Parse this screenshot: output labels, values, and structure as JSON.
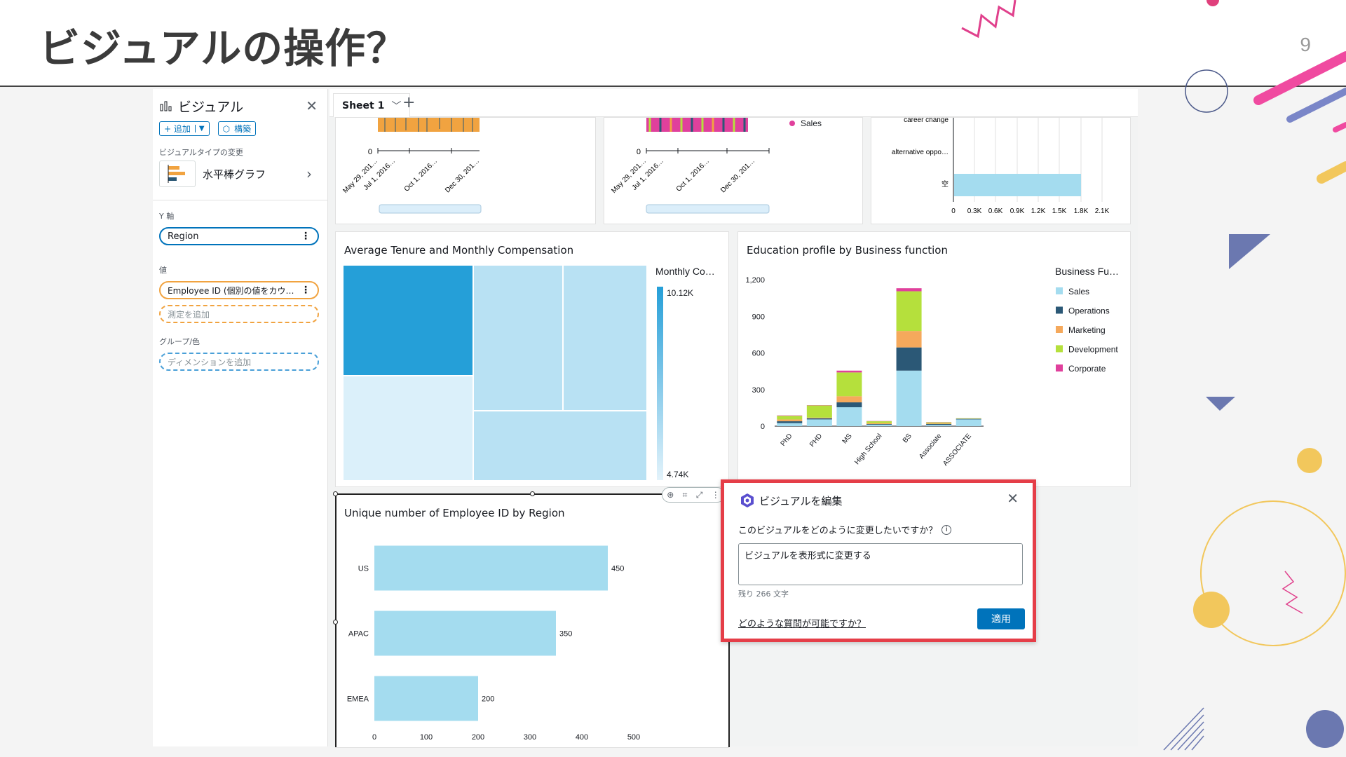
{
  "slide": {
    "title": "ビジュアルの操作？",
    "page_number": "9"
  },
  "left_panel": {
    "title": "ビジュアル",
    "add_button": "+ 追加",
    "build_button": "構築",
    "visual_type_label": "ビジュアルタイプの変更",
    "visual_type_name": "水平棒グラフ",
    "y_axis_label": "Y 軸",
    "y_axis_field": "Region",
    "value_label": "値",
    "value_field": "Employee ID (個別の値をカウ…",
    "add_measure": "測定を追加",
    "group_label": "グループ/色",
    "add_dimension": "ディメンションを追加"
  },
  "sheet_tab": {
    "label": "Sheet 1"
  },
  "top_charts": {
    "left": {
      "zero": "0",
      "dates": [
        "May 29, 201…",
        "Jul 1, 2016…",
        "Oct 1, 2016…",
        "Dec 30, 201…"
      ]
    },
    "middle": {
      "zero": "0",
      "dates": [
        "May 29, 201…",
        "Jul 1, 2016…",
        "Oct 1, 2016…",
        "Dec 30, 201…"
      ],
      "legend": "Sales"
    },
    "right": {
      "categories": [
        "career change",
        "alternative oppo…",
        "空"
      ],
      "ticks": [
        "0",
        "0.3K",
        "0.6K",
        "0.9K",
        "1.2K",
        "1.5K",
        "1.8K",
        "2.1K"
      ]
    }
  },
  "treemap_card": {
    "title": "Average Tenure and Monthly Compensation",
    "legend_title": "Monthly Co…",
    "legend_max": "10.12K",
    "legend_min": "4.74K"
  },
  "education_card": {
    "title": "Education profile by Business function",
    "legend_title": "Business Fu…"
  },
  "bar_card": {
    "title": "Unique number of Employee ID by Region"
  },
  "edit_popup": {
    "title": "ビジュアルを編集",
    "question": "このビジュアルをどのように変更したいですか？",
    "input_value": "ビジュアルを表形式に変更する",
    "remaining": "残り 266 文字",
    "help_link": "どのような質問が可能ですか？",
    "apply": "適用"
  },
  "colors": {
    "accent_blue": "#0073bb",
    "highlight_red": "#e53e48",
    "sales": "#a4dcef",
    "operations": "#2b5876",
    "marketing": "#f5a95c",
    "development": "#b5e03c",
    "corporate": "#e0409c"
  },
  "chart_data": [
    {
      "type": "bar",
      "orientation": "horizontal",
      "title": "Unique number of Employee ID by Region",
      "categories": [
        "US",
        "APAC",
        "EMEA"
      ],
      "values": [
        450,
        350,
        200
      ],
      "xlim": [
        0,
        500
      ],
      "xticks": [
        "0",
        "100",
        "200",
        "300",
        "400",
        "500"
      ]
    },
    {
      "type": "bar",
      "stacked": true,
      "title": "Education profile by Business function",
      "categories": [
        "PhD",
        "PHD",
        "MS",
        "High School",
        "BS",
        "Associate",
        "ASSOCIATE"
      ],
      "yticks": [
        "0",
        "300",
        "600",
        "900",
        "1,200"
      ],
      "ylim": [
        0,
        1200
      ],
      "legend_position": "right",
      "series": [
        {
          "name": "Sales",
          "values": [
            25,
            55,
            155,
            12,
            455,
            10,
            55
          ]
        },
        {
          "name": "Operations",
          "values": [
            15,
            10,
            40,
            5,
            190,
            8,
            5
          ]
        },
        {
          "name": "Marketing",
          "values": [
            15,
            5,
            50,
            8,
            135,
            5,
            2
          ]
        },
        {
          "name": "Development",
          "values": [
            30,
            100,
            195,
            15,
            325,
            8,
            3
          ]
        },
        {
          "name": "Corporate",
          "values": [
            3,
            2,
            15,
            2,
            25,
            2,
            0
          ]
        }
      ]
    },
    {
      "type": "heatmap",
      "title": "Average Tenure and Monthly Compensation",
      "color_range": [
        "4.74K",
        "10.12K"
      ]
    }
  ]
}
